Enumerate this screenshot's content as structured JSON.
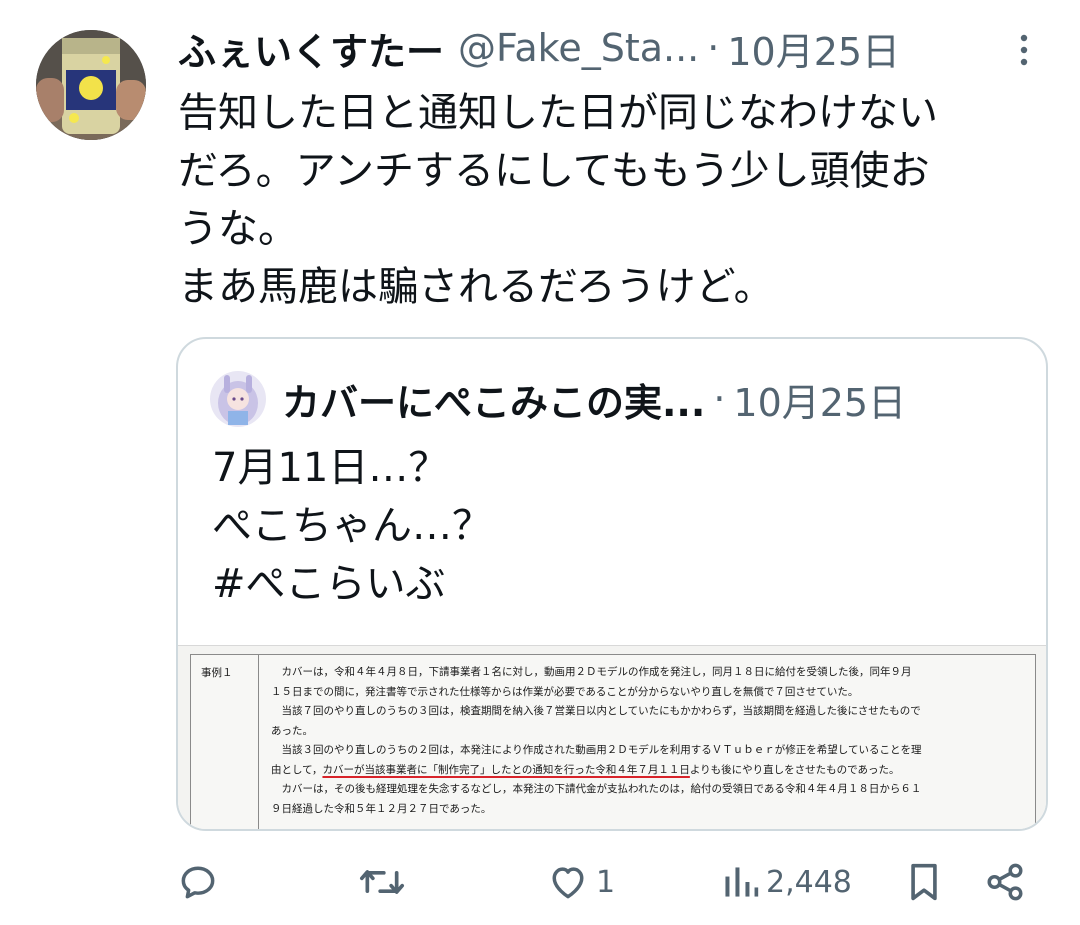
{
  "tweet": {
    "display_name": "ふぇいくすたー",
    "handle": "@Fake_Sta...",
    "separator": "·",
    "date": "10月25日",
    "text_lines": [
      "告知した日と通知した日が同じなわけない",
      "だろ。アンチするにしてももう少し頭使お",
      "うな。",
      "まあ馬鹿は騙されるだろうけど。"
    ]
  },
  "quote": {
    "display_name": "カバーにぺこみこの実...",
    "separator": "·",
    "date": "10月25日",
    "text_lines": [
      "7月11日…？",
      "ぺこちゃん…？",
      "#ぺこらいぶ"
    ],
    "document": {
      "label": "事例１",
      "lines": [
        "　カバーは，令和４年４月８日，下請事業者１名に対し，動画用２Ｄモデルの作成を発注し，同月１８日に給付を受領した後，同年９月",
        "１５日までの間に，発注書等で示された仕様等からは作業が必要であることが分からないやり直しを無償で７回させていた。",
        "　当該７回のやり直しのうちの３回は，検査期間を納入後７営業日以内としていたにもかかわらず，当該期間を経過した後にさせたもので",
        "あった。",
        "　当該３回のやり直しのうちの２回は，本発注により作成された動画用２Ｄモデルを利用するＶＴｕｂｅｒが修正を希望していることを理"
      ],
      "line_6_before": "由として，",
      "line_6_underlined": "カバーが当該事業者に「制作完了」したとの通知を行った令和４年７月１１日",
      "line_6_after": "よりも後にやり直しをさせたものであった。",
      "lines_after": [
        "　カバーは，その後も経理処理を失念するなどし，本発注の下請代金が支払われたのは，給付の受領日である令和４年４月１８日から６１",
        "９日経過した令和５年１２月２７日であった。"
      ]
    }
  },
  "actions": {
    "reply_count": "",
    "retweet_count": "",
    "like_count": "1",
    "views_count": "2,448"
  },
  "icons": {
    "reply": "reply-icon",
    "retweet": "retweet-icon",
    "like": "heart-icon",
    "views": "views-icon",
    "bookmark": "bookmark-icon",
    "share": "share-icon",
    "more": "more-icon"
  },
  "colors": {
    "text": "#0f1419",
    "secondary": "#536471",
    "border": "#cfd9de",
    "underline": "#d8232a"
  }
}
